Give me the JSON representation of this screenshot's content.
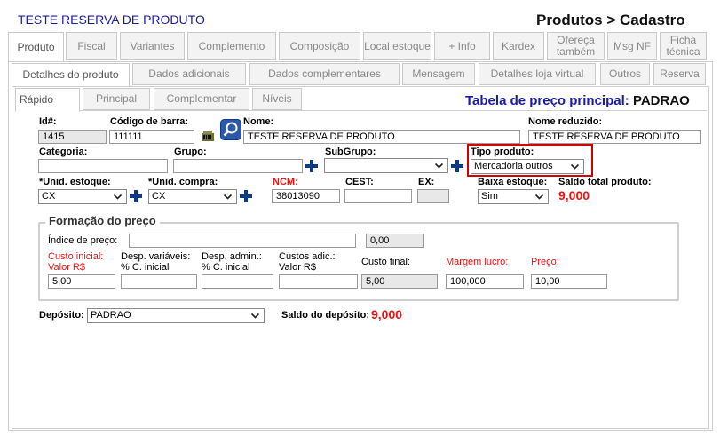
{
  "header": {
    "title": "TESTE RESERVA DE PRODUTO",
    "breadcrumb": "Produtos > Cadastro"
  },
  "tabs_main": [
    {
      "label": "Produto"
    },
    {
      "label": "Fiscal"
    },
    {
      "label": "Variantes"
    },
    {
      "label": "Complemento"
    },
    {
      "label": "Composição"
    },
    {
      "label": "Local estoque"
    },
    {
      "label": "+ Info"
    },
    {
      "label": "Kardex"
    },
    {
      "label": "Ofereça também"
    },
    {
      "label": "Msg NF"
    },
    {
      "label": "Ficha técnica"
    }
  ],
  "tabs_sub": [
    {
      "label": "Detalhes do produto"
    },
    {
      "label": "Dados adicionais"
    },
    {
      "label": "Dados complementares"
    },
    {
      "label": "Mensagem"
    },
    {
      "label": "Detalhes loja virtual"
    },
    {
      "label": "Outros"
    },
    {
      "label": "Reserva"
    }
  ],
  "tabs_inner": [
    {
      "label": "Rápido"
    },
    {
      "label": "Principal"
    },
    {
      "label": "Complementar"
    },
    {
      "label": "Níveis"
    }
  ],
  "price_table": {
    "label": "Tabela de preço principal:",
    "value": "PADRAO"
  },
  "fields": {
    "id": {
      "label": "Id#:",
      "value": "1415"
    },
    "barcode": {
      "label": "Código de barra:",
      "value": "111111"
    },
    "nome": {
      "label": "Nome:",
      "value": "TESTE RESERVA DE PRODUTO"
    },
    "nome_reduzido": {
      "label": "Nome reduzido:",
      "value": "TESTE RESERVA DE PRODUTO"
    },
    "categoria": {
      "label": "Categoria:",
      "value": ""
    },
    "grupo": {
      "label": "Grupo:",
      "value": ""
    },
    "subgrupo": {
      "label": "SubGrupo:",
      "value": ""
    },
    "tipo_produto": {
      "label": "Tipo produto:",
      "value": "Mercadoria outros"
    },
    "unid_estoque": {
      "label": "*Unid. estoque:",
      "value": "CX"
    },
    "unid_compra": {
      "label": "*Unid. compra:",
      "value": "CX"
    },
    "ncm": {
      "label": "NCM:",
      "value": "38013090"
    },
    "cest": {
      "label": "CEST:",
      "value": ""
    },
    "ex": {
      "label": "EX:",
      "value": ""
    },
    "baixa_estoque": {
      "label": "Baixa estoque:",
      "value": "Sim"
    },
    "saldo_total": {
      "label": "Saldo total produto:",
      "value": "9,000"
    }
  },
  "pricing": {
    "legend": "Formação do preço",
    "indice": {
      "label": "Índice de preço:",
      "value": "",
      "value2": "0,00"
    },
    "custo_inicial": {
      "label1": "Custo inicial:",
      "label2": "Valor R$",
      "value": "5,00"
    },
    "desp_variaveis": {
      "label1": "Desp. variáveis:",
      "label2": "% C. inicial",
      "value": ""
    },
    "desp_admin": {
      "label1": "Desp. admin.:",
      "label2": "% C. inicial",
      "value": ""
    },
    "custos_adic": {
      "label1": "Custos adic.:",
      "label2": "Valor R$",
      "value": ""
    },
    "custo_final": {
      "label": "Custo final:",
      "value": "5,00"
    },
    "margem": {
      "label": "Margem lucro:",
      "value": "100,000"
    },
    "preco": {
      "label": "Preço:",
      "value": "10,00"
    }
  },
  "deposito": {
    "label": "Depósito:",
    "value": "PADRAO",
    "saldo_label": "Saldo do depósito:",
    "saldo_value": "9,000"
  },
  "colors": {
    "accent_blue": "#1a1aa6",
    "red": "#e11111",
    "highlight": "#d40000"
  }
}
